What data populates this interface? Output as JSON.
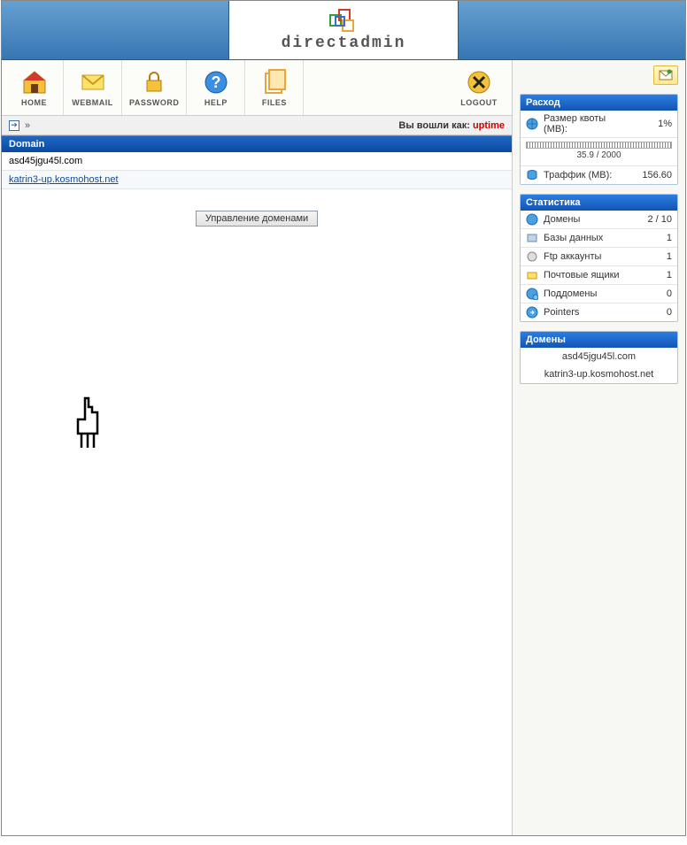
{
  "brand": "directadmin",
  "toolbar": {
    "home": "HOME",
    "webmail": "WEBMAIL",
    "password": "PASSWORD",
    "help": "HELP",
    "files": "FILES",
    "logout": "LOGOUT"
  },
  "crumb": {
    "logged_in_as_label": "Вы вошли как:",
    "user": "uptime"
  },
  "domain_section": {
    "header": "Domain",
    "domains": [
      "asd45jgu45l.com",
      "katrin3-up.kosmohost.net"
    ],
    "manage_label": "Управление доменами"
  },
  "usage_panel": {
    "title": "Расход",
    "quota_label": "Размер квоты (MB):",
    "quota_pct": "1%",
    "quota_text": "35.9 / 2000",
    "traffic_label": "Траффик (MB):",
    "traffic_val": "156.60"
  },
  "stats_panel": {
    "title": "Статистика",
    "rows": [
      {
        "label": "Домены",
        "val": "2 / 10"
      },
      {
        "label": "Базы данных",
        "val": "1"
      },
      {
        "label": "Ftp аккаунты",
        "val": "1"
      },
      {
        "label": "Почтовые ящики",
        "val": "1"
      },
      {
        "label": "Поддомены",
        "val": "0"
      },
      {
        "label": "Pointers",
        "val": "0"
      }
    ]
  },
  "domains_panel": {
    "title": "Домены",
    "items": [
      "asd45jgu45l.com",
      "katrin3-up.kosmohost.net"
    ]
  }
}
